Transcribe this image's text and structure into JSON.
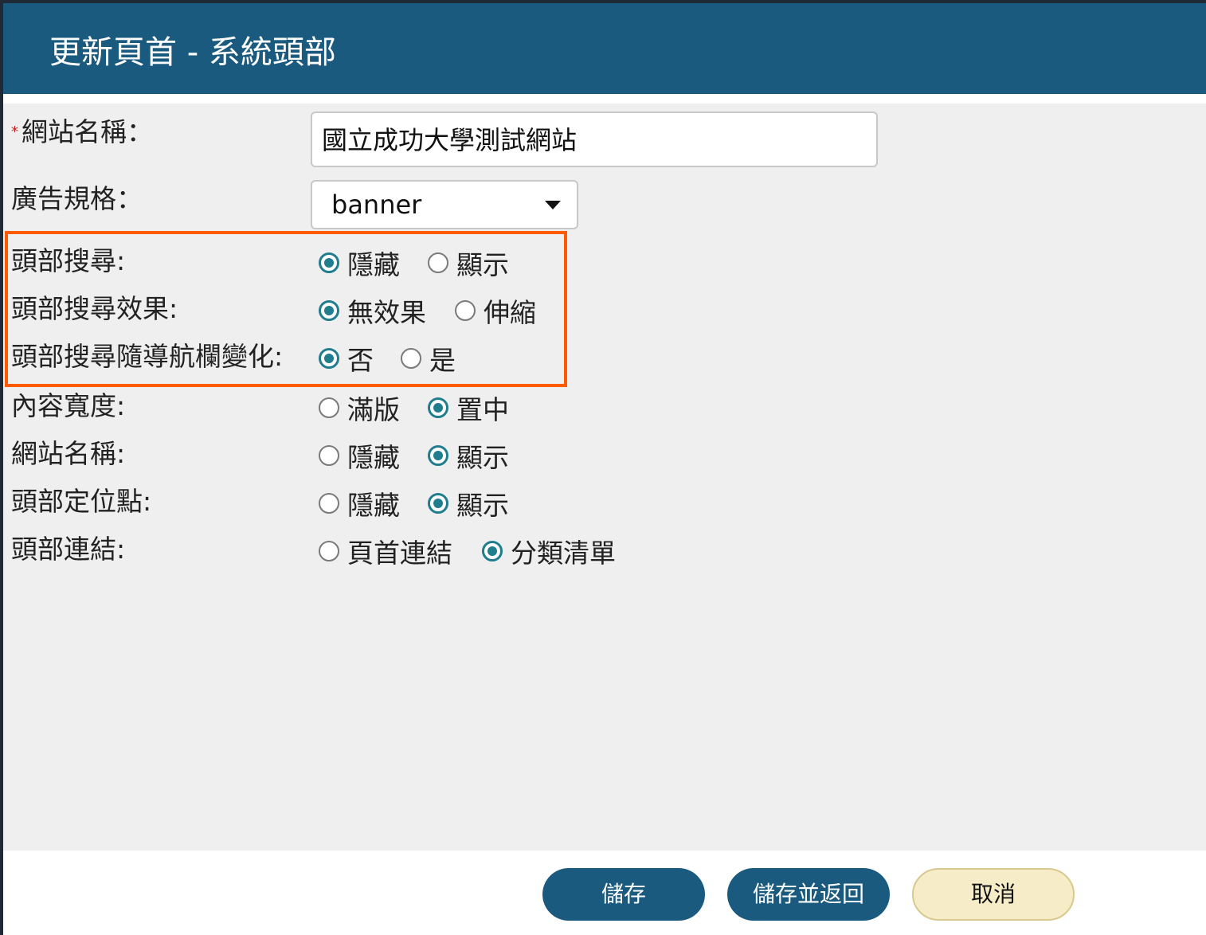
{
  "dialog": {
    "title": "更新頁首 - 系統頭部"
  },
  "form": {
    "site_name": {
      "label": "網站名稱：",
      "required_mark": "*",
      "value": "國立成功大學測試網站"
    },
    "ad_spec": {
      "label": "廣告規格：",
      "selected": "banner"
    },
    "radios": [
      {
        "label": "頭部搜尋:",
        "options": [
          "隱藏",
          "顯示"
        ],
        "selected": 0
      },
      {
        "label": "頭部搜尋效果:",
        "options": [
          "無效果",
          "伸縮"
        ],
        "selected": 0
      },
      {
        "label": "頭部搜尋隨導航欄變化:",
        "options": [
          "否",
          "是"
        ],
        "selected": 0
      },
      {
        "label": "內容寬度:",
        "options": [
          "滿版",
          "置中"
        ],
        "selected": 1
      },
      {
        "label": "網站名稱:",
        "options": [
          "隱藏",
          "顯示"
        ],
        "selected": 1
      },
      {
        "label": "頭部定位點:",
        "options": [
          "隱藏",
          "顯示"
        ],
        "selected": 1
      },
      {
        "label": "頭部連結:",
        "options": [
          "頁首連結",
          "分類清單"
        ],
        "selected": 1
      }
    ]
  },
  "footer": {
    "save": "儲存",
    "save_return": "儲存並返回",
    "cancel": "取消"
  },
  "colors": {
    "header": "#1a5a7f",
    "accent": "#1f7d8e",
    "highlight": "#ff5a00",
    "cancel_bg": "#f6edc8"
  }
}
